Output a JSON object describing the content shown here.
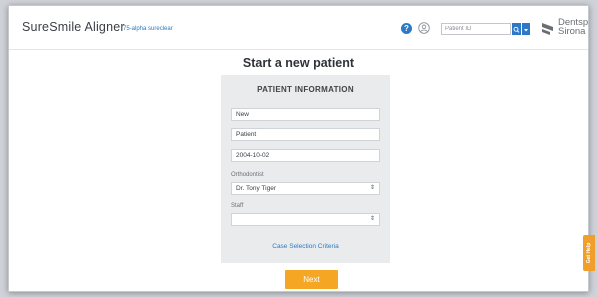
{
  "header": {
    "app_title": "SureSmile Aligner",
    "account_link": "75-alpha sureclear",
    "help_icon": "question-mark-icon",
    "help_glyph": "?",
    "user_icon": "user-circle-icon",
    "search": {
      "placeholder": "Patient ID",
      "value": ""
    },
    "search_button_icon": "search-icon",
    "search_dropdown_icon": "chevron-down-icon",
    "logo": {
      "line1": "Dentsply",
      "line2": "Sirona"
    }
  },
  "page": {
    "title": "Start a new patient"
  },
  "form": {
    "section_title": "PATIENT INFORMATION",
    "first_name_value": "New",
    "last_name_value": "Patient",
    "dob_value": "2004-10-02",
    "orthodontist_label": "Orthodontist",
    "orthodontist_value": "Dr. Tony Tiger",
    "staff_label": "Staff",
    "staff_value": "",
    "select_arrow": "⇕",
    "case_selection_link": "Case Selection Criteria",
    "next_button": "Next"
  },
  "feedback_tab": {
    "label": "Get Help"
  },
  "colors": {
    "accent_orange": "#f5a623",
    "link_blue": "#2c7bc0",
    "icon_blue": "#2d79c7",
    "panel_bg": "#eaebed"
  }
}
